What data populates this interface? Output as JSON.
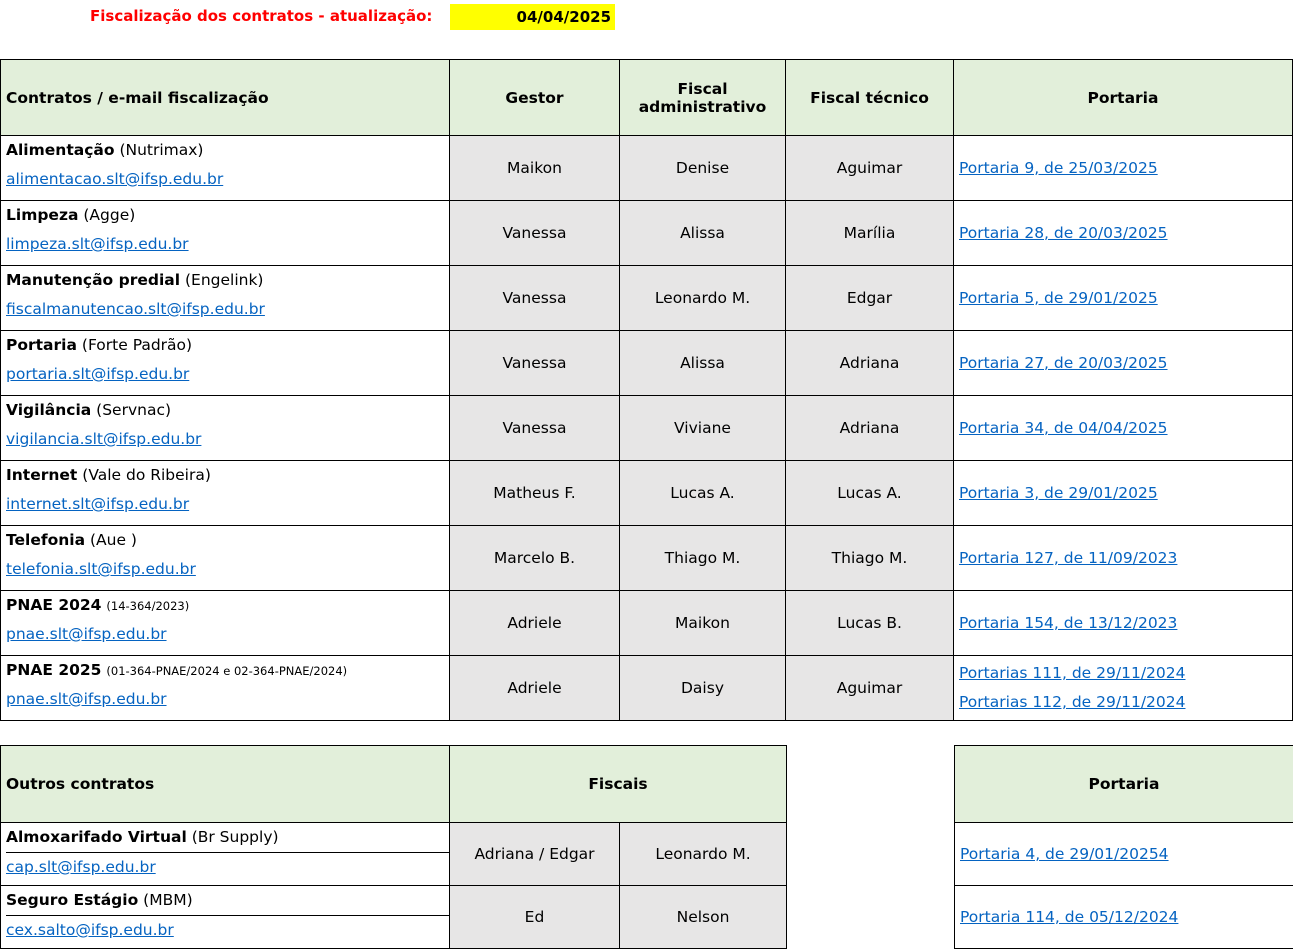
{
  "header": {
    "title": "Fiscalização dos contratos - atualização:",
    "date": "04/04/2025"
  },
  "main_table": {
    "headers": {
      "contracts": "Contratos / e-mail fiscalização",
      "gestor": "Gestor",
      "fiscal_admin": "Fiscal administrativo",
      "fiscal_tecnico": "Fiscal técnico",
      "portaria": "Portaria"
    },
    "rows": [
      {
        "name": "Alimentação",
        "detail": "(Nutrimax)",
        "email": "alimentacao.slt@ifsp.edu.br",
        "gestor": "Maikon",
        "admin": "Denise",
        "tecnico": "Aguimar",
        "portarias": [
          "Portaria 9, de 25/03/2025"
        ]
      },
      {
        "name": "Limpeza",
        "detail": "(Agge)",
        "email": "limpeza.slt@ifsp.edu.br",
        "gestor": "Vanessa",
        "admin": "Alissa",
        "tecnico": "Marília",
        "portarias": [
          "Portaria 28, de 20/03/2025"
        ]
      },
      {
        "name": "Manutenção predial",
        "detail": "(Engelink)",
        "email": "fiscalmanutencao.slt@ifsp.edu.br",
        "gestor": "Vanessa",
        "admin": "Leonardo M.",
        "tecnico": "Edgar",
        "portarias": [
          "Portaria 5, de 29/01/2025"
        ]
      },
      {
        "name": "Portaria",
        "detail": "(Forte Padrão)",
        "email": "portaria.slt@ifsp.edu.br",
        "gestor": "Vanessa",
        "admin": "Alissa",
        "tecnico": "Adriana",
        "portarias": [
          "Portaria 27, de 20/03/2025"
        ]
      },
      {
        "name": "Vigilância",
        "detail": "(Servnac)",
        "email": "vigilancia.slt@ifsp.edu.br",
        "gestor": "Vanessa",
        "admin": "Viviane",
        "tecnico": "Adriana",
        "portarias": [
          "Portaria 34, de 04/04/2025"
        ]
      },
      {
        "name": "Internet",
        "detail": "(Vale do Ribeira)",
        "email": "internet.slt@ifsp.edu.br",
        "gestor": "Matheus F.",
        "admin": "Lucas A.",
        "tecnico": "Lucas A.",
        "portarias": [
          "Portaria 3, de 29/01/2025"
        ]
      },
      {
        "name": "Telefonia",
        "detail": "(Aue )",
        "email": "telefonia.slt@ifsp.edu.br",
        "gestor": "Marcelo B.",
        "admin": "Thiago M.",
        "tecnico": "Thiago M.",
        "portarias": [
          "Portaria 127, de 11/09/2023"
        ]
      },
      {
        "name": "PNAE 2024",
        "detail": "(14-364/2023)",
        "small": true,
        "email": "pnae.slt@ifsp.edu.br",
        "gestor": "Adriele",
        "admin": "Maikon",
        "tecnico": "Lucas B.",
        "portarias": [
          "Portaria 154, de 13/12/2023"
        ]
      },
      {
        "name": "PNAE 2025",
        "detail": "(01-364-PNAE/2024 e 02-364-PNAE/2024)",
        "small": true,
        "email": "pnae.slt@ifsp.edu.br",
        "gestor": "Adriele",
        "admin": "Daisy",
        "tecnico": "Aguimar",
        "portarias": [
          "Portarias 111, de 29/11/2024",
          "Portarias 112, de 29/11/2024"
        ]
      }
    ]
  },
  "other_table": {
    "headers": {
      "contracts": "Outros contratos",
      "fiscais": "Fiscais",
      "portaria": "Portaria"
    },
    "rows": [
      {
        "name": "Almoxarifado Virtual",
        "detail": "(Br Supply)",
        "email": "cap.slt@ifsp.edu.br",
        "fiscal1": "Adriana / Edgar",
        "fiscal2": "Leonardo M.",
        "portaria": "Portaria 4, de 29/01/20254"
      },
      {
        "name": "Seguro Estágio",
        "detail": "(MBM)",
        "email": "cex.salto@ifsp.edu.br",
        "fiscal1": "Ed",
        "fiscal2": "Nelson",
        "portaria": "Portaria 114, de 05/12/2024"
      }
    ]
  },
  "colors": {
    "header_bg": "#e2efda",
    "cell_grey": "#e7e6e6",
    "link": "#0563c1",
    "title_red": "#ff0000",
    "highlight_yellow": "#ffff00"
  }
}
